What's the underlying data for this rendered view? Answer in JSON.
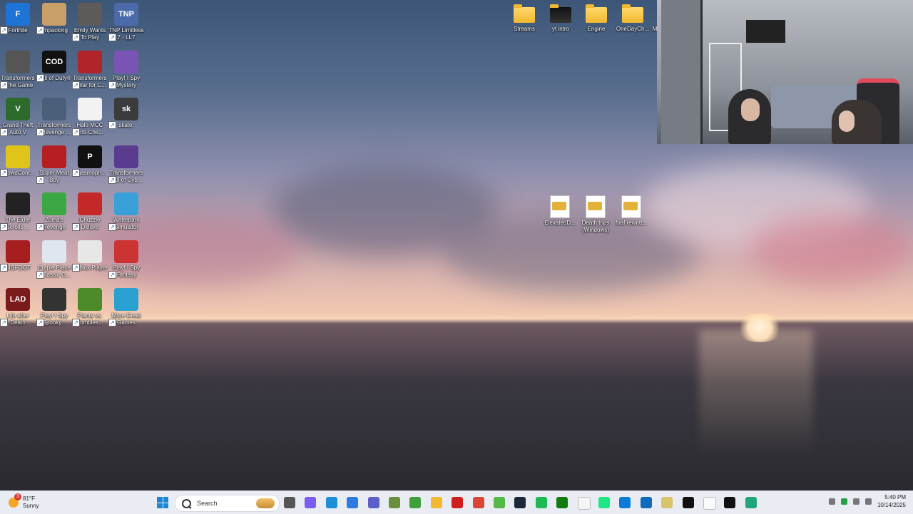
{
  "desktop_icons": [
    {
      "label": "Fortnite",
      "color": "#1e73d6",
      "glyph": "F"
    },
    {
      "label": "Unpacking",
      "color": "#c9a067",
      "glyph": ""
    },
    {
      "label": "Emily Wants To Play",
      "color": "#5e5a58",
      "glyph": ""
    },
    {
      "label": "TNP Limitless 7 - LL7",
      "color": "#4a6aa8",
      "glyph": "TNP"
    },
    {
      "label": "Transformers - The Game",
      "color": "#555",
      "glyph": ""
    },
    {
      "label": "Call of Duty®",
      "color": "#111",
      "glyph": "COD"
    },
    {
      "label": "Transformers - War for C...",
      "color": "#b1252a",
      "glyph": ""
    },
    {
      "label": "Play! I Spy Mystery",
      "color": "#7a54b5",
      "glyph": ""
    },
    {
      "label": "Grand Theft Auto V",
      "color": "#2d6b2d",
      "glyph": "V"
    },
    {
      "label": "Transformers - Revenge ...",
      "color": "#4a5f7a",
      "glyph": ""
    },
    {
      "label": "Halo MCC Anti-Che...",
      "color": "#f2f2f2",
      "glyph": ""
    },
    {
      "label": "skate.",
      "color": "#3b3b3b",
      "glyph": "sk"
    },
    {
      "label": "CrowdCont...",
      "color": "#e0c41a",
      "glyph": ""
    },
    {
      "label": "Super Meat Boy",
      "color": "#b51f22",
      "glyph": ""
    },
    {
      "label": "Phasmoph...",
      "color": "#111",
      "glyph": "P"
    },
    {
      "label": "Transformers Fall of Cyb...",
      "color": "#5a3b8f",
      "glyph": ""
    },
    {
      "label": "The Elder Scrolls ...",
      "color": "#222",
      "glyph": ""
    },
    {
      "label": "Zuma's Revenge",
      "color": "#3ba843",
      "glyph": ""
    },
    {
      "label": "Chuzzle Deluxe",
      "color": "#c42828",
      "glyph": ""
    },
    {
      "label": "Waterpark Simulator",
      "color": "#3aa0d8",
      "glyph": ""
    },
    {
      "label": "BIGFOOT",
      "color": "#a71e1e",
      "glyph": ""
    },
    {
      "label": "Purple Place - Classic G...",
      "color": "#dfe6f0",
      "glyph": ""
    },
    {
      "label": "Roblox Player",
      "color": "#e7e7e7",
      "glyph": ""
    },
    {
      "label": "Play! I Spy Fantasy",
      "color": "#c33",
      "glyph": ""
    },
    {
      "label": "Life after Death",
      "color": "#7a1c1c",
      "glyph": "LAD"
    },
    {
      "label": "Play! I Spy Spooky...",
      "color": "#333",
      "glyph": ""
    },
    {
      "label": "Plants vs. Zombies...",
      "color": "#4d8a2a",
      "glyph": ""
    },
    {
      "label": "More Great Games",
      "color": "#2aa0d0",
      "glyph": ""
    }
  ],
  "top_folders": [
    {
      "label": "Streams"
    },
    {
      "label": "yt intro"
    },
    {
      "label": "Engine"
    },
    {
      "label": "OneDayCh..."
    },
    {
      "label": "M"
    }
  ],
  "zip_files": [
    {
      "label": "ElevatedD..."
    },
    {
      "label": "Death trips (Windows)"
    },
    {
      "label": "fnaf rewritt..."
    }
  ],
  "taskbar": {
    "weather_temp": "81°F",
    "weather_desc": "Sunny",
    "weather_badge": "3",
    "search_placeholder": "Search",
    "apps": [
      {
        "name": "task-view-icon",
        "color": "#555"
      },
      {
        "name": "copilot-icon",
        "color": "#7b5cf0"
      },
      {
        "name": "edge-icon",
        "color": "#1c8fd6"
      },
      {
        "name": "store-icon",
        "color": "#2d7be0"
      },
      {
        "name": "teams-icon",
        "color": "#5b5fc7"
      },
      {
        "name": "minecraft-icon",
        "color": "#6a8f3a"
      },
      {
        "name": "creeper-icon",
        "color": "#3fa03a"
      },
      {
        "name": "file-explorer-icon",
        "color": "#f2b830"
      },
      {
        "name": "netflix-icon",
        "color": "#d01f1f"
      },
      {
        "name": "chrome-icon",
        "color": "#db4437"
      },
      {
        "name": "xbox-game-icon",
        "color": "#54b948"
      },
      {
        "name": "steam-icon",
        "color": "#1b2838"
      },
      {
        "name": "spotify-icon",
        "color": "#1db954"
      },
      {
        "name": "xbox-icon",
        "color": "#107c10"
      },
      {
        "name": "document-icon",
        "color": "#f5f5f5"
      },
      {
        "name": "hulu-icon",
        "color": "#1ce783"
      },
      {
        "name": "globe-icon",
        "color": "#0a7bd6"
      },
      {
        "name": "outlook-icon",
        "color": "#0f6cbd"
      },
      {
        "name": "notepad-icon",
        "color": "#d8c46a"
      },
      {
        "name": "appletv-icon",
        "color": "#111"
      },
      {
        "name": "blank-doc-icon",
        "color": "#fafafa"
      },
      {
        "name": "tiktok-icon",
        "color": "#111"
      },
      {
        "name": "app-active-icon",
        "color": "#1fa67a"
      }
    ],
    "time": "5:40 PM",
    "date": "10/14/2025"
  }
}
